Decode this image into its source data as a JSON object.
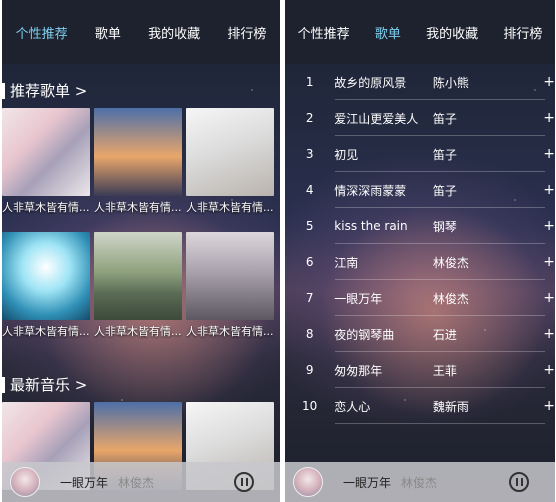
{
  "left": {
    "tabs": [
      {
        "label": "个性推荐",
        "active": true
      },
      {
        "label": "歌单",
        "active": false
      },
      {
        "label": "我的收藏",
        "active": false
      },
      {
        "label": "排行榜",
        "active": false
      }
    ],
    "recommended": {
      "heading": "推荐歌单 >",
      "cards": [
        {
          "caption": "人非草木皆有情..."
        },
        {
          "caption": "人非草木皆有情..."
        },
        {
          "caption": "人非草木皆有情..."
        },
        {
          "caption": "人非草木皆有情..."
        },
        {
          "caption": "人非草木皆有情..."
        },
        {
          "caption": "人非草木皆有情..."
        }
      ]
    },
    "latest": {
      "heading": "最新音乐 >"
    },
    "player": {
      "title": "一眼万年",
      "artist": "林俊杰"
    }
  },
  "right": {
    "tabs": [
      {
        "label": "个性推荐",
        "active": false
      },
      {
        "label": "歌单",
        "active": true
      },
      {
        "label": "我的收藏",
        "active": false
      },
      {
        "label": "排行榜",
        "active": false
      }
    ],
    "songs": [
      {
        "num": "1",
        "title": "故乡的原风景",
        "artist": "陈小熊"
      },
      {
        "num": "2",
        "title": "爱江山更爱美人",
        "artist": "笛子"
      },
      {
        "num": "3",
        "title": "初见",
        "artist": "笛子"
      },
      {
        "num": "4",
        "title": "情深深雨蒙蒙",
        "artist": "笛子"
      },
      {
        "num": "5",
        "title": "kiss the rain",
        "artist": "钢琴"
      },
      {
        "num": "6",
        "title": "江南",
        "artist": "林俊杰"
      },
      {
        "num": "7",
        "title": "一眼万年",
        "artist": "林俊杰"
      },
      {
        "num": "8",
        "title": "夜的钢琴曲",
        "artist": "石进"
      },
      {
        "num": "9",
        "title": "匆匆那年",
        "artist": "王菲"
      },
      {
        "num": "10",
        "title": "恋人心",
        "artist": "魏新雨"
      }
    ],
    "add_symbol": "+",
    "player": {
      "title": "一眼万年",
      "artist": "林俊杰"
    }
  }
}
